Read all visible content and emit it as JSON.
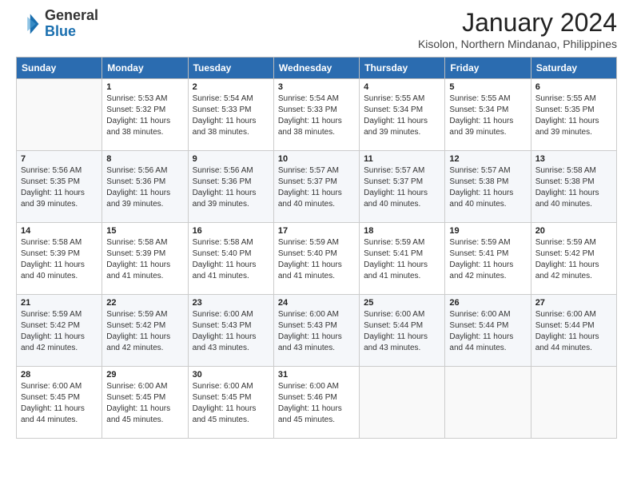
{
  "header": {
    "logo_general": "General",
    "logo_blue": "Blue",
    "month_title": "January 2024",
    "location": "Kisolon, Northern Mindanao, Philippines"
  },
  "days_of_week": [
    "Sunday",
    "Monday",
    "Tuesday",
    "Wednesday",
    "Thursday",
    "Friday",
    "Saturday"
  ],
  "weeks": [
    [
      {
        "day": "",
        "sunrise": "",
        "sunset": "",
        "daylight": ""
      },
      {
        "day": "1",
        "sunrise": "Sunrise: 5:53 AM",
        "sunset": "Sunset: 5:32 PM",
        "daylight": "Daylight: 11 hours and 38 minutes."
      },
      {
        "day": "2",
        "sunrise": "Sunrise: 5:54 AM",
        "sunset": "Sunset: 5:33 PM",
        "daylight": "Daylight: 11 hours and 38 minutes."
      },
      {
        "day": "3",
        "sunrise": "Sunrise: 5:54 AM",
        "sunset": "Sunset: 5:33 PM",
        "daylight": "Daylight: 11 hours and 38 minutes."
      },
      {
        "day": "4",
        "sunrise": "Sunrise: 5:55 AM",
        "sunset": "Sunset: 5:34 PM",
        "daylight": "Daylight: 11 hours and 39 minutes."
      },
      {
        "day": "5",
        "sunrise": "Sunrise: 5:55 AM",
        "sunset": "Sunset: 5:34 PM",
        "daylight": "Daylight: 11 hours and 39 minutes."
      },
      {
        "day": "6",
        "sunrise": "Sunrise: 5:55 AM",
        "sunset": "Sunset: 5:35 PM",
        "daylight": "Daylight: 11 hours and 39 minutes."
      }
    ],
    [
      {
        "day": "7",
        "sunrise": "Sunrise: 5:56 AM",
        "sunset": "Sunset: 5:35 PM",
        "daylight": "Daylight: 11 hours and 39 minutes."
      },
      {
        "day": "8",
        "sunrise": "Sunrise: 5:56 AM",
        "sunset": "Sunset: 5:36 PM",
        "daylight": "Daylight: 11 hours and 39 minutes."
      },
      {
        "day": "9",
        "sunrise": "Sunrise: 5:56 AM",
        "sunset": "Sunset: 5:36 PM",
        "daylight": "Daylight: 11 hours and 39 minutes."
      },
      {
        "day": "10",
        "sunrise": "Sunrise: 5:57 AM",
        "sunset": "Sunset: 5:37 PM",
        "daylight": "Daylight: 11 hours and 40 minutes."
      },
      {
        "day": "11",
        "sunrise": "Sunrise: 5:57 AM",
        "sunset": "Sunset: 5:37 PM",
        "daylight": "Daylight: 11 hours and 40 minutes."
      },
      {
        "day": "12",
        "sunrise": "Sunrise: 5:57 AM",
        "sunset": "Sunset: 5:38 PM",
        "daylight": "Daylight: 11 hours and 40 minutes."
      },
      {
        "day": "13",
        "sunrise": "Sunrise: 5:58 AM",
        "sunset": "Sunset: 5:38 PM",
        "daylight": "Daylight: 11 hours and 40 minutes."
      }
    ],
    [
      {
        "day": "14",
        "sunrise": "Sunrise: 5:58 AM",
        "sunset": "Sunset: 5:39 PM",
        "daylight": "Daylight: 11 hours and 40 minutes."
      },
      {
        "day": "15",
        "sunrise": "Sunrise: 5:58 AM",
        "sunset": "Sunset: 5:39 PM",
        "daylight": "Daylight: 11 hours and 41 minutes."
      },
      {
        "day": "16",
        "sunrise": "Sunrise: 5:58 AM",
        "sunset": "Sunset: 5:40 PM",
        "daylight": "Daylight: 11 hours and 41 minutes."
      },
      {
        "day": "17",
        "sunrise": "Sunrise: 5:59 AM",
        "sunset": "Sunset: 5:40 PM",
        "daylight": "Daylight: 11 hours and 41 minutes."
      },
      {
        "day": "18",
        "sunrise": "Sunrise: 5:59 AM",
        "sunset": "Sunset: 5:41 PM",
        "daylight": "Daylight: 11 hours and 41 minutes."
      },
      {
        "day": "19",
        "sunrise": "Sunrise: 5:59 AM",
        "sunset": "Sunset: 5:41 PM",
        "daylight": "Daylight: 11 hours and 42 minutes."
      },
      {
        "day": "20",
        "sunrise": "Sunrise: 5:59 AM",
        "sunset": "Sunset: 5:42 PM",
        "daylight": "Daylight: 11 hours and 42 minutes."
      }
    ],
    [
      {
        "day": "21",
        "sunrise": "Sunrise: 5:59 AM",
        "sunset": "Sunset: 5:42 PM",
        "daylight": "Daylight: 11 hours and 42 minutes."
      },
      {
        "day": "22",
        "sunrise": "Sunrise: 5:59 AM",
        "sunset": "Sunset: 5:42 PM",
        "daylight": "Daylight: 11 hours and 42 minutes."
      },
      {
        "day": "23",
        "sunrise": "Sunrise: 6:00 AM",
        "sunset": "Sunset: 5:43 PM",
        "daylight": "Daylight: 11 hours and 43 minutes."
      },
      {
        "day": "24",
        "sunrise": "Sunrise: 6:00 AM",
        "sunset": "Sunset: 5:43 PM",
        "daylight": "Daylight: 11 hours and 43 minutes."
      },
      {
        "day": "25",
        "sunrise": "Sunrise: 6:00 AM",
        "sunset": "Sunset: 5:44 PM",
        "daylight": "Daylight: 11 hours and 43 minutes."
      },
      {
        "day": "26",
        "sunrise": "Sunrise: 6:00 AM",
        "sunset": "Sunset: 5:44 PM",
        "daylight": "Daylight: 11 hours and 44 minutes."
      },
      {
        "day": "27",
        "sunrise": "Sunrise: 6:00 AM",
        "sunset": "Sunset: 5:44 PM",
        "daylight": "Daylight: 11 hours and 44 minutes."
      }
    ],
    [
      {
        "day": "28",
        "sunrise": "Sunrise: 6:00 AM",
        "sunset": "Sunset: 5:45 PM",
        "daylight": "Daylight: 11 hours and 44 minutes."
      },
      {
        "day": "29",
        "sunrise": "Sunrise: 6:00 AM",
        "sunset": "Sunset: 5:45 PM",
        "daylight": "Daylight: 11 hours and 45 minutes."
      },
      {
        "day": "30",
        "sunrise": "Sunrise: 6:00 AM",
        "sunset": "Sunset: 5:45 PM",
        "daylight": "Daylight: 11 hours and 45 minutes."
      },
      {
        "day": "31",
        "sunrise": "Sunrise: 6:00 AM",
        "sunset": "Sunset: 5:46 PM",
        "daylight": "Daylight: 11 hours and 45 minutes."
      },
      {
        "day": "",
        "sunrise": "",
        "sunset": "",
        "daylight": ""
      },
      {
        "day": "",
        "sunrise": "",
        "sunset": "",
        "daylight": ""
      },
      {
        "day": "",
        "sunrise": "",
        "sunset": "",
        "daylight": ""
      }
    ]
  ]
}
